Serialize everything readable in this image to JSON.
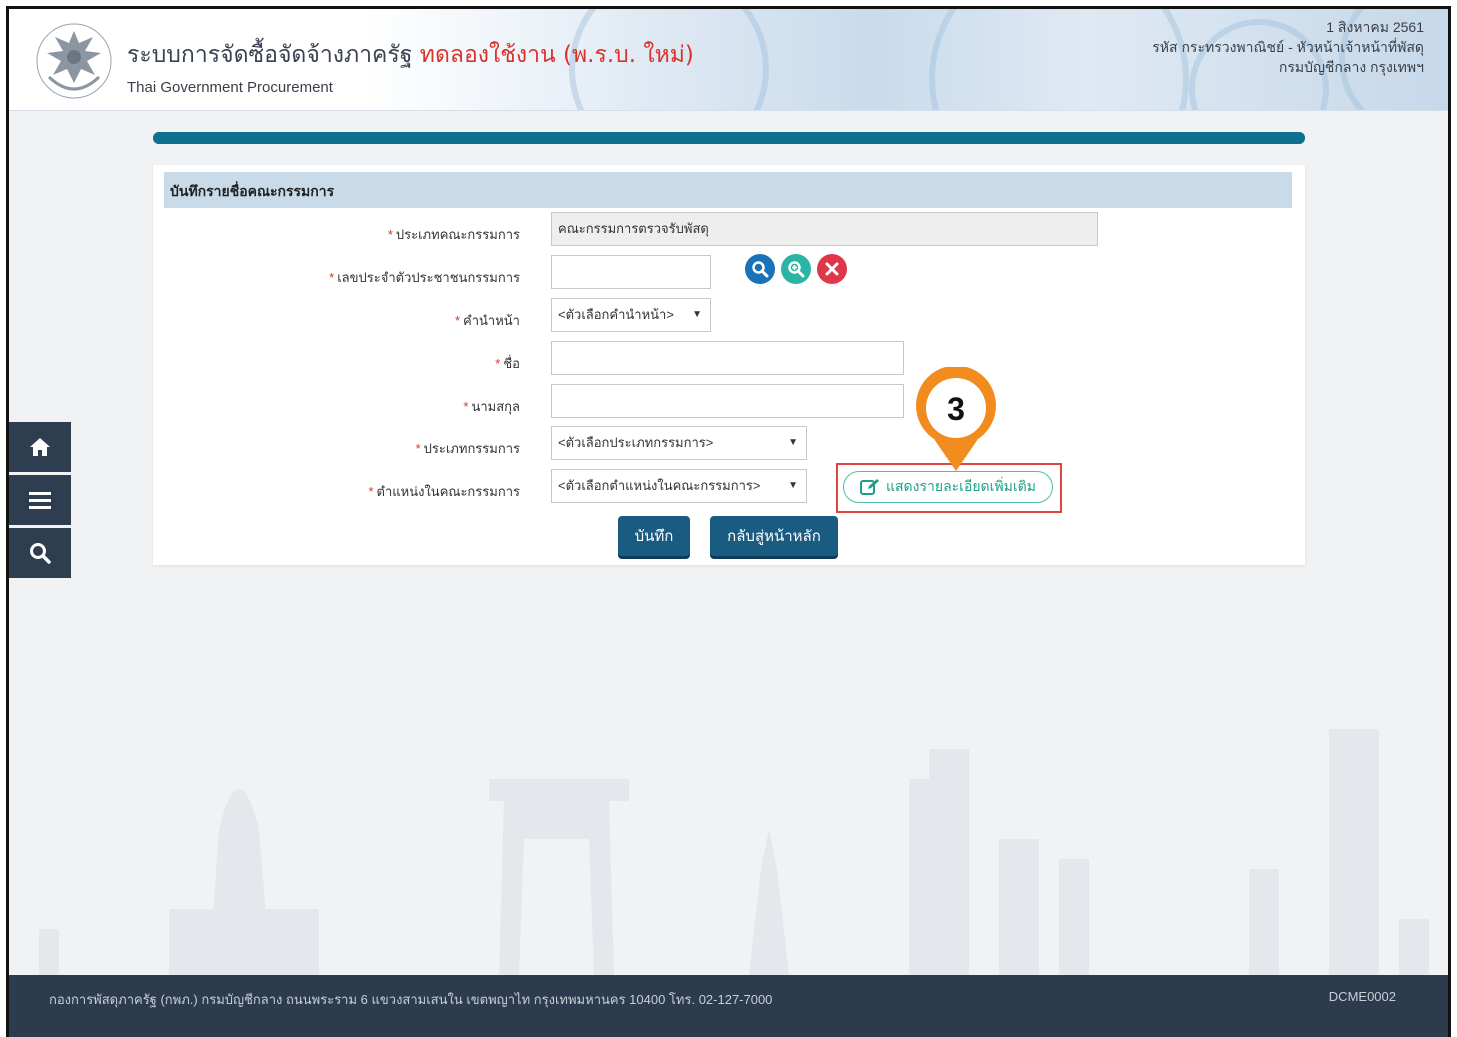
{
  "header": {
    "title_th": "ระบบการจัดซื้อจัดจ้างภาครัฐ",
    "title_th_highlight": "ทดลองใช้งาน (พ.ร.บ. ใหม่)",
    "title_en": "Thai Government Procurement",
    "date": "1 สิงหาคม 2561",
    "user_line": "รหัส กระทรวงพาณิชย์ - หัวหน้าเจ้าหน้าที่พัสดุ",
    "org_line": "กรมบัญชีกลาง กรุงเทพฯ"
  },
  "progress": {
    "percent": 100
  },
  "panel": {
    "title": "บันทึกรายชื่อคณะกรรมการ",
    "fields": {
      "committee_type": {
        "label": "ประเภทคณะกรรมการ",
        "value": "คณะกรรมการตรวจรับพัสดุ"
      },
      "id_number": {
        "label": "เลขประจำตัวประชาชนกรรมการ",
        "value": ""
      },
      "prefix": {
        "label": "คำนำหน้า",
        "value": "<ตัวเลือกคำนำหน้า>"
      },
      "first_name": {
        "label": "ชื่อ",
        "value": ""
      },
      "last_name": {
        "label": "นามสกุล",
        "value": ""
      },
      "member_type": {
        "label": "ประเภทกรรมการ",
        "value": "<ตัวเลือกประเภทกรรมการ>"
      },
      "position": {
        "label": "ตำแหน่งในคณะกรรมการ",
        "value": "<ตัวเลือกตำแหน่งในคณะกรรมการ>"
      }
    },
    "required_mark": "*",
    "more_details_label": "แสดงรายละเอียดเพิ่มเติม",
    "save_label": "บันทึก",
    "back_label": "กลับสู่หน้าหลัก"
  },
  "marker": {
    "number": "3",
    "color": "#f28c1e"
  },
  "icons": {
    "search": "search-icon",
    "zoom": "zoom-in-icon",
    "clear": "close-icon",
    "home": "home-icon",
    "menu": "menu-icon",
    "side_search": "search-icon",
    "edit": "edit-icon"
  },
  "colors": {
    "primary": "#1a5b82",
    "sidebar": "#2e3e50",
    "footer": "#2c3b4e",
    "required": "#d8332b",
    "accent_teal": "#1f9f86"
  },
  "footer": {
    "address": "กองการพัสดุภาครัฐ (กพภ.) กรมบัญชีกลาง ถนนพระราม 6 แขวงสามเสนใน เขตพญาไท กรุงเทพมหานคร 10400 โทร. 02-127-7000",
    "page_code": "DCME0002"
  }
}
